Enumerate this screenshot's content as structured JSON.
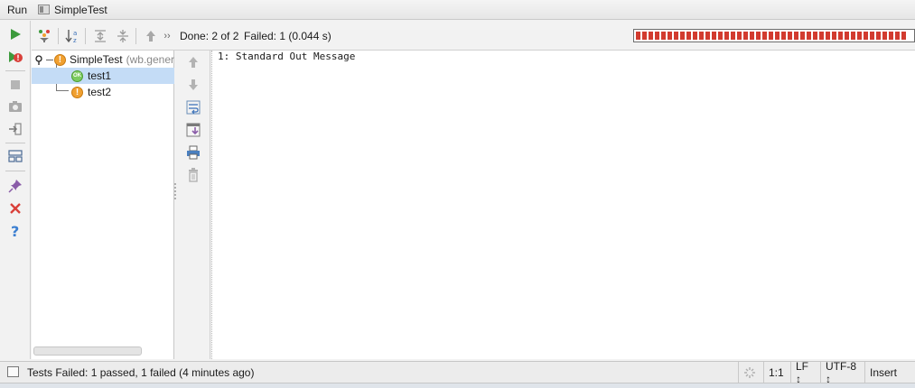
{
  "titlebar": {
    "run_label": "Run",
    "tab_label": "SimpleTest"
  },
  "test_status": {
    "done_text": "Done: 2 of 2",
    "failed_text": "Failed: 1 (0.044 s)",
    "progress_color": "#d23b2f",
    "progress_fraction": 1.0
  },
  "tree": {
    "root": {
      "label": "SimpleTest",
      "suffix": "(wb.gener",
      "status": "warning"
    },
    "children": [
      {
        "label": "test1",
        "status": "ok",
        "badge": "OK",
        "selected": true
      },
      {
        "label": "test2",
        "status": "warning",
        "badge": "!",
        "selected": false
      }
    ]
  },
  "console": {
    "lines": [
      "1: Standard Out Message"
    ]
  },
  "statusbar": {
    "message": "Tests Failed: 1 passed, 1 failed (4 minutes ago)",
    "position": "1:1",
    "line_separator": "LF ↕",
    "encoding": "UTF-8 ↕",
    "insert_mode": "Insert"
  },
  "icons": {
    "left_toolbar": [
      "run-icon",
      "rerun-failed-icon",
      "stop-icon",
      "screenshot-icon",
      "export-icon",
      "layout-icon",
      "pin-icon",
      "close-icon",
      "help-icon"
    ],
    "tree_toolbar": [
      "filter-icon",
      "sort-alpha-icon",
      "expand-all-icon",
      "collapse-all-icon",
      "previous-failed-icon",
      "more-icon"
    ],
    "console_toolbar": [
      "up-arrow-icon",
      "down-arrow-icon",
      "soft-wrap-icon",
      "scroll-to-end-icon",
      "print-icon",
      "clear-icon"
    ]
  }
}
